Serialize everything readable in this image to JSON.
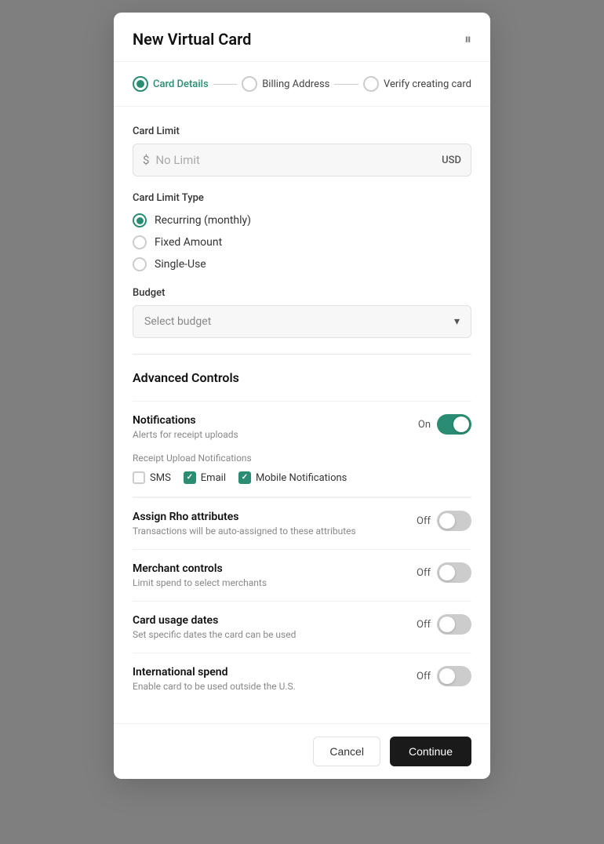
{
  "modal": {
    "title": "New Virtual Card",
    "icon": "⏸"
  },
  "stepper": {
    "steps": [
      {
        "label": "Card Details",
        "state": "active"
      },
      {
        "label": "Billing Address",
        "state": "inactive"
      },
      {
        "label": "Verify creating card",
        "state": "inactive"
      }
    ]
  },
  "cardLimit": {
    "label": "Card Limit",
    "placeholder": "No Limit",
    "currency": "USD",
    "symbol": "$"
  },
  "cardLimitType": {
    "label": "Card Limit Type",
    "options": [
      {
        "id": "recurring",
        "label": "Recurring (monthly)",
        "selected": true
      },
      {
        "id": "fixed",
        "label": "Fixed Amount",
        "selected": false
      },
      {
        "id": "single",
        "label": "Single-Use",
        "selected": false
      }
    ]
  },
  "budget": {
    "label": "Budget",
    "placeholder": "Select budget"
  },
  "advancedControls": {
    "title": "Advanced Controls",
    "controls": [
      {
        "id": "notifications",
        "title": "Notifications",
        "desc": "Alerts for receipt uploads",
        "toggleState": "on",
        "toggleLabel": "On"
      },
      {
        "id": "assign-rho",
        "title": "Assign Rho attributes",
        "desc": "Transactions will be auto-assigned to these attributes",
        "toggleState": "off",
        "toggleLabel": "Off"
      },
      {
        "id": "merchant-controls",
        "title": "Merchant controls",
        "desc": "Limit spend to select merchants",
        "toggleState": "off",
        "toggleLabel": "Off"
      },
      {
        "id": "card-usage-dates",
        "title": "Card usage dates",
        "desc": "Set specific dates the card can be used",
        "toggleState": "off",
        "toggleLabel": "Off"
      },
      {
        "id": "international-spend",
        "title": "International spend",
        "desc": "Enable card to be used outside the U.S.",
        "toggleState": "off",
        "toggleLabel": "Off"
      }
    ]
  },
  "receiptNotifications": {
    "label": "Receipt Upload Notifications",
    "options": [
      {
        "id": "sms",
        "label": "SMS",
        "checked": false
      },
      {
        "id": "email",
        "label": "Email",
        "checked": true
      },
      {
        "id": "mobile",
        "label": "Mobile Notifications",
        "checked": true
      }
    ]
  },
  "footer": {
    "cancelLabel": "Cancel",
    "continueLabel": "Continue"
  }
}
